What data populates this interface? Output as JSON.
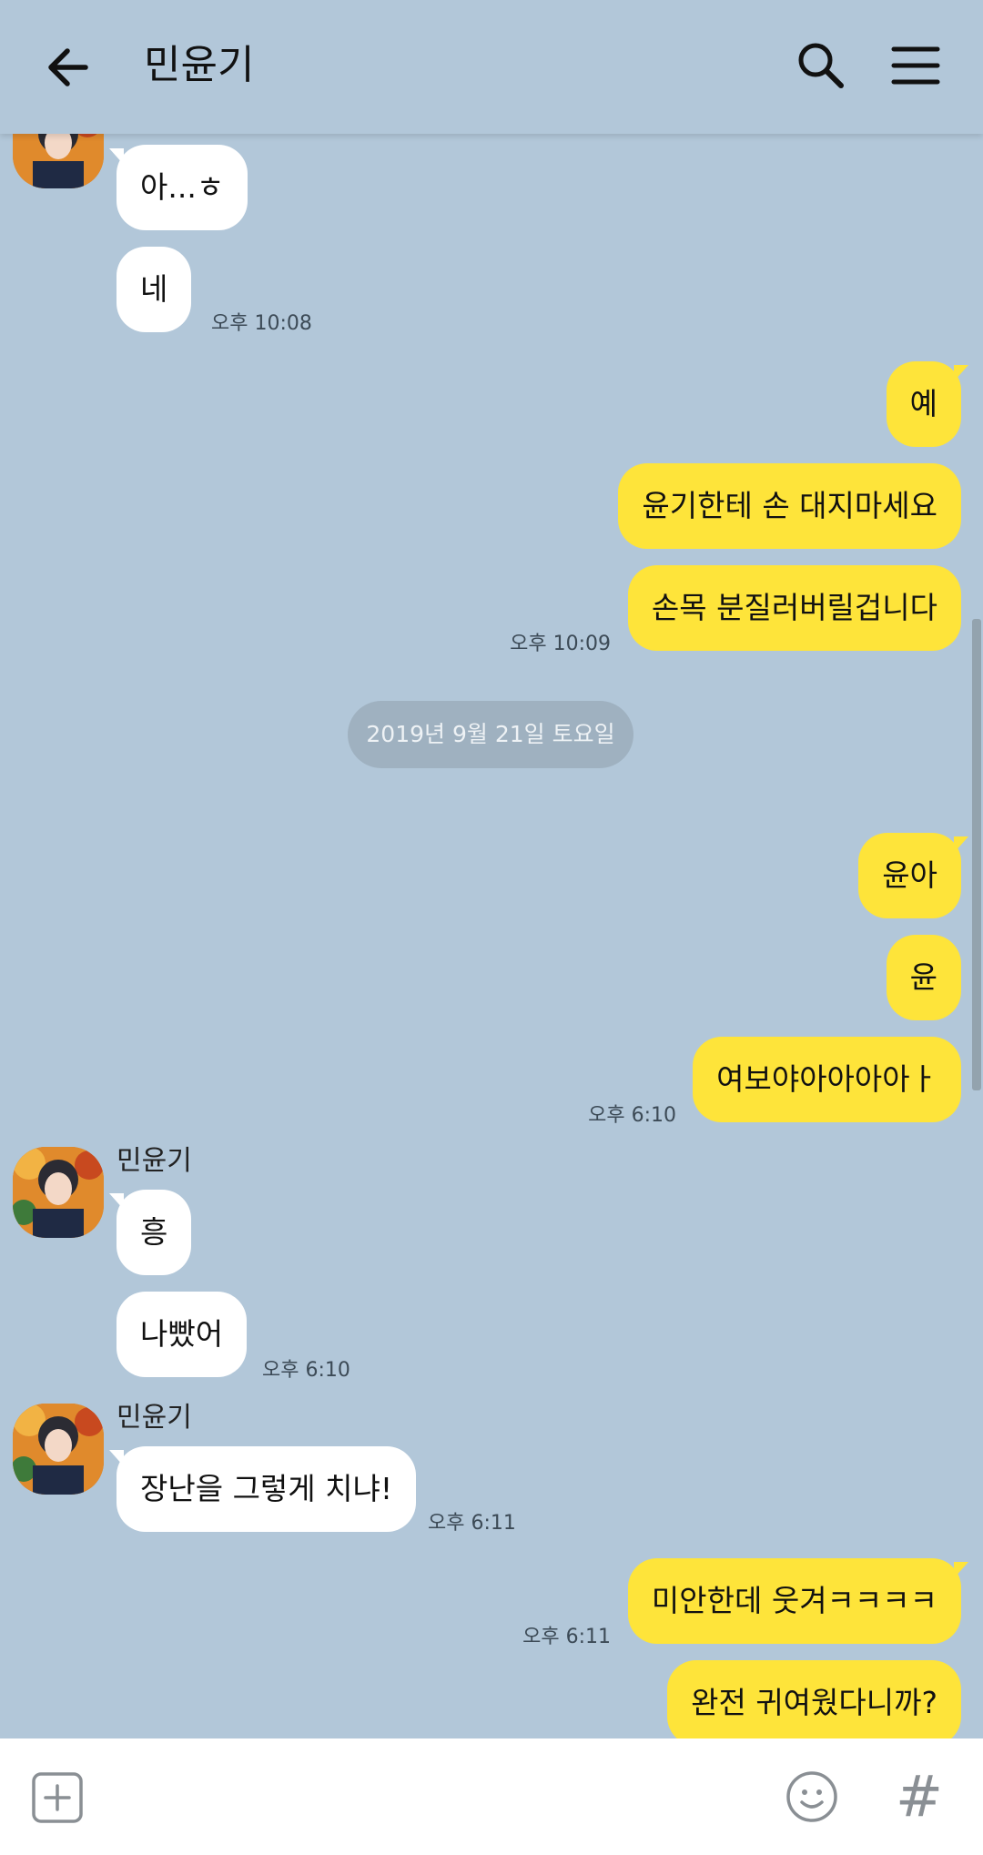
{
  "header": {
    "title": "민윤기",
    "back_icon": "arrow-left-icon",
    "search_icon": "search-icon",
    "menu_icon": "hamburger-menu-icon"
  },
  "date_divider": "2019년 9월 21일 토요일",
  "messages": [
    {
      "dir": "in",
      "text": "아...ㅎ"
    },
    {
      "dir": "in",
      "text": "네",
      "time": "오후 10:08"
    },
    {
      "dir": "out",
      "text": "예"
    },
    {
      "dir": "out",
      "text": "윤기한테 손 대지마세요"
    },
    {
      "dir": "out",
      "text": "손목 분질러버릴겁니다",
      "time": "오후 10:09"
    },
    {
      "dir": "out",
      "text": "윤아"
    },
    {
      "dir": "out",
      "text": "윤"
    },
    {
      "dir": "out",
      "text": "여보야아아아아ㅏ",
      "time": "오후 6:10"
    },
    {
      "dir": "in",
      "sender": "민윤기",
      "text": "흥"
    },
    {
      "dir": "in",
      "text": "나빴어",
      "time": "오후 6:10"
    },
    {
      "dir": "in",
      "sender": "민윤기",
      "text": "장난을 그렇게 치냐!",
      "time": "오후 6:11"
    },
    {
      "dir": "out",
      "text": "미안한데 웃겨ㅋㅋㅋㅋ",
      "time": "오후 6:11"
    },
    {
      "dir": "out",
      "text": "완전 귀여웠다니까?"
    }
  ],
  "input_bar": {
    "add_icon": "plus-square-icon",
    "emoji_icon": "smiley-icon",
    "hashtag": "#"
  },
  "colors": {
    "background": "#b2c7d9",
    "incoming_bubble": "#ffffff",
    "outgoing_bubble": "#fee43a"
  }
}
